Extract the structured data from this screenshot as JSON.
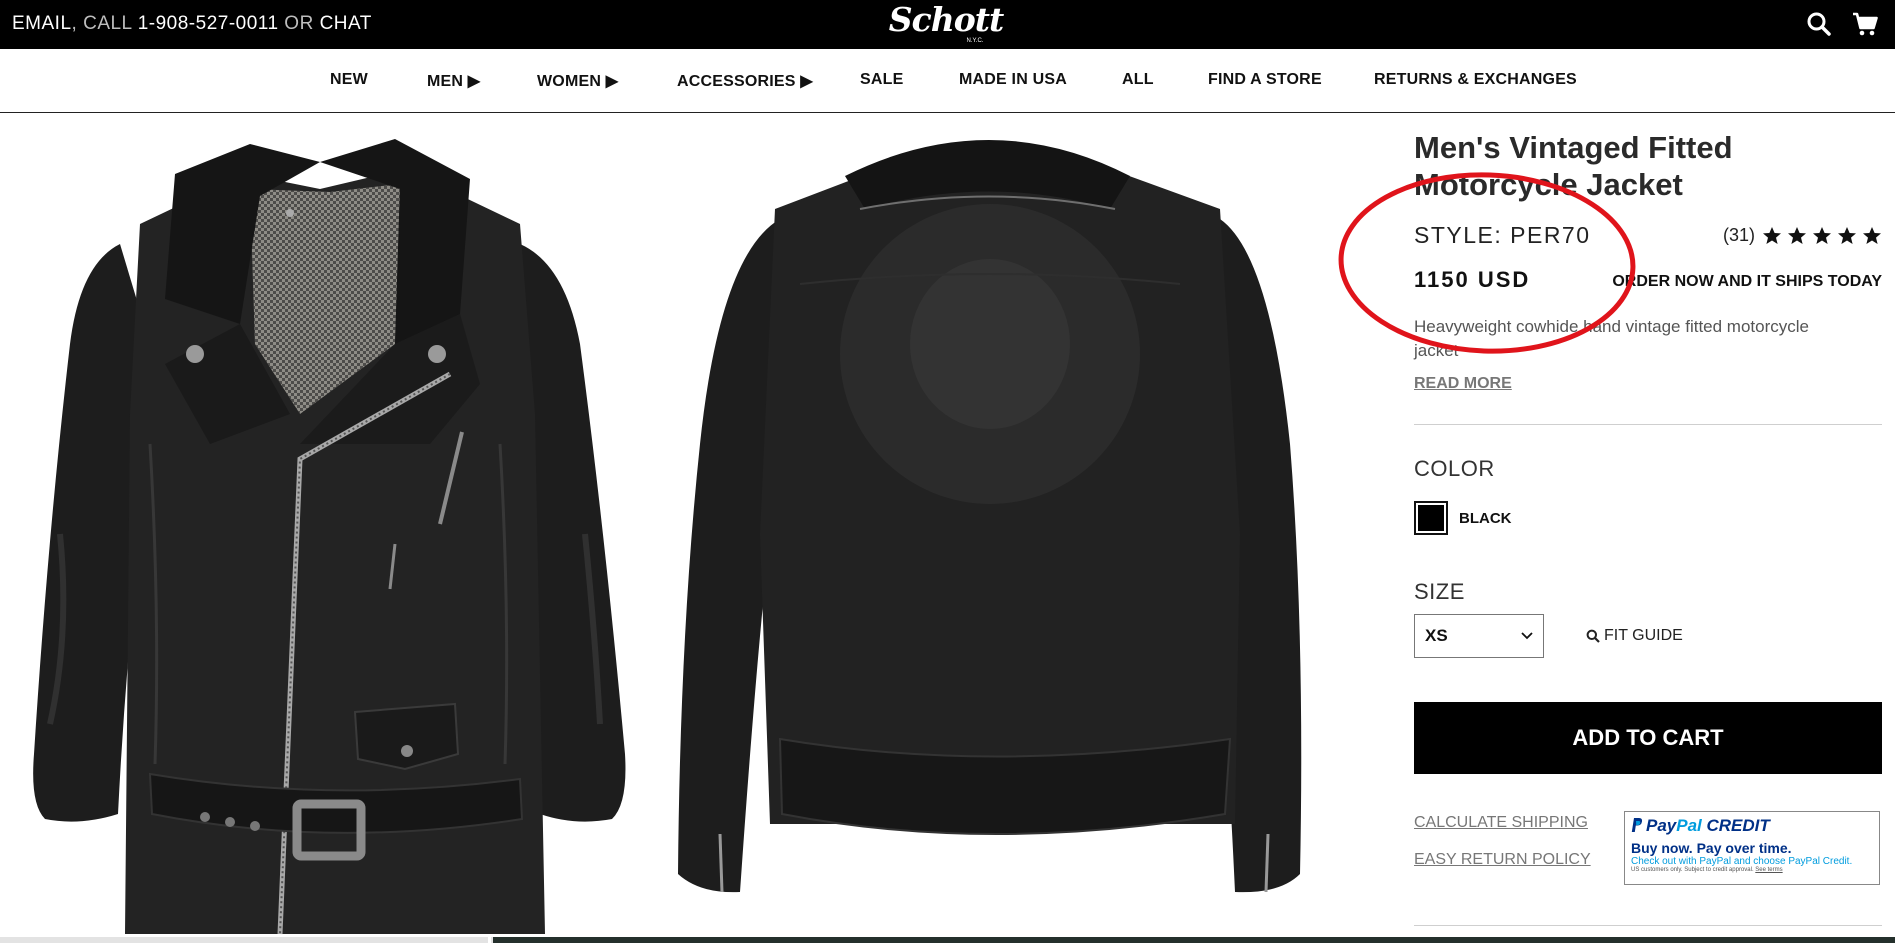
{
  "topbar": {
    "email_label": "EMAIL",
    "sep1": ", ",
    "call_label": "CALL",
    "phone": "1-908-527-0011",
    "or_label": "OR",
    "chat_label": "CHAT",
    "brand": "Schott",
    "brand_sub": "N.Y.C.",
    "icons": [
      "search-icon",
      "cart-icon"
    ]
  },
  "nav": {
    "items": [
      {
        "label": "NEW"
      },
      {
        "label": "MEN ▶"
      },
      {
        "label": "WOMEN ▶"
      },
      {
        "label": "ACCESSORIES ▶"
      },
      {
        "label": "SALE"
      },
      {
        "label": "MADE IN USA"
      },
      {
        "label": "ALL"
      },
      {
        "label": "FIND A STORE"
      },
      {
        "label": "RETURNS & EXCHANGES"
      }
    ]
  },
  "gallery": {
    "images": [
      "front-view",
      "back-view"
    ],
    "progress": 0.26
  },
  "product": {
    "title": "Men's Vintaged Fitted Motorcycle Jacket",
    "style": "STYLE: PER70",
    "review_count": "(31)",
    "rating": 5,
    "price": "1150 USD",
    "shipping_note": "ORDER NOW AND IT SHIPS TODAY",
    "description": "Heavyweight cowhide hand vintage fitted motorcycle jacket",
    "read_more": "READ MORE",
    "color_label": "COLOR",
    "color_name": "BLACK",
    "color_hex": "#000000",
    "size_label": "SIZE",
    "size_value": "XS",
    "fit_guide": "FIT GUIDE",
    "add_to_cart": "ADD TO CART",
    "calc_shipping": "CALCULATE SHIPPING",
    "return_policy": "EASY RETURN POLICY"
  },
  "paypal": {
    "brand_a": "Pay",
    "brand_b": "Pal",
    "brand_c": " CREDIT",
    "line1": "Buy now. Pay over time.",
    "line2": "Check out with PayPal and choose PayPal Credit.",
    "line3": "US customers only. Subject to credit approval.",
    "terms": "See terms"
  },
  "colors": {
    "annotation": "#e0141b",
    "paypal_navy": "#003087",
    "paypal_blue": "#009cde"
  }
}
